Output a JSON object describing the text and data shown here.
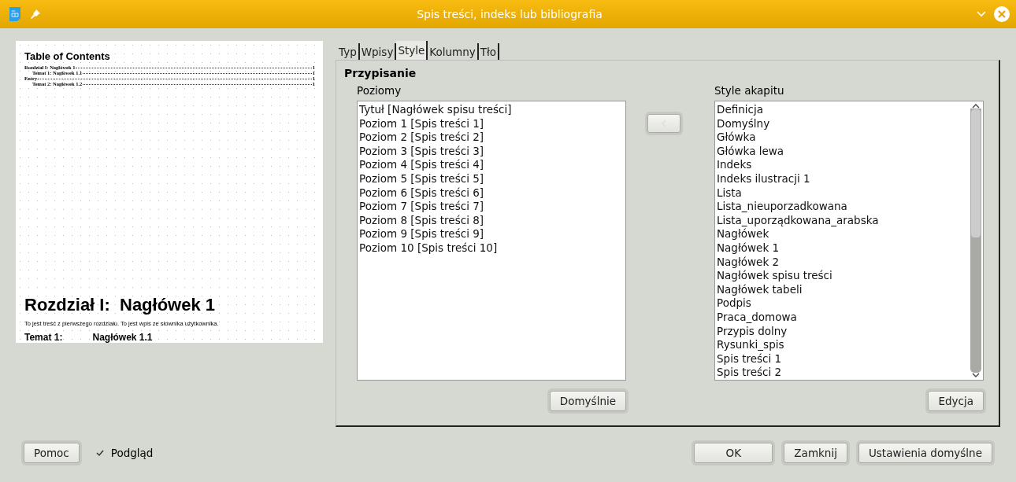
{
  "window": {
    "title": "Spis treści, indeks lub bibliografia"
  },
  "preview": {
    "toc_title": "Table of Contents",
    "toc_entries": [
      {
        "text": "Rozdział I: Nagłówek 1",
        "page": "1",
        "children": [
          {
            "text": "Temat 1: Nagłówek 1.1",
            "page": "1"
          }
        ]
      },
      {
        "text": "Entry",
        "page": "1",
        "children": [
          {
            "text": "Temat 2: Nagłówek 1.2",
            "page": "1"
          }
        ]
      }
    ],
    "heading": "Rozdział I:  Nagłówek 1",
    "body": "To jest treść z pierwszego rozdziału. To jest wpis ze słownika użytkownika.",
    "subheading": {
      "number": "Temat 1:",
      "title": "Nagłówek 1.1"
    }
  },
  "tabs": [
    {
      "label": "Typ",
      "selected": false
    },
    {
      "label": "Wpisy",
      "selected": false
    },
    {
      "label": "Style",
      "selected": true
    },
    {
      "label": "Kolumny",
      "selected": false
    },
    {
      "label": "Tło",
      "selected": false
    }
  ],
  "section_title": "Przypisanie",
  "levels": {
    "label": "Poziomy",
    "items": [
      "Tytuł [Nagłówek spisu treści]",
      "Poziom 1 [Spis treści 1]",
      "Poziom 2 [Spis treści 2]",
      "Poziom 3 [Spis treści 3]",
      "Poziom 4 [Spis treści 4]",
      "Poziom 5 [Spis treści 5]",
      "Poziom 6 [Spis treści 6]",
      "Poziom 7 [Spis treści 7]",
      "Poziom 8 [Spis treści 8]",
      "Poziom 9 [Spis treści 9]",
      "Poziom 10 [Spis treści 10]"
    ]
  },
  "assign_button": {
    "disabled": true
  },
  "styles": {
    "label": "Style akapitu",
    "items": [
      "Definicja",
      "Domyślny",
      "Główka",
      "Główka lewa",
      "Indeks",
      "Indeks ilustracji 1",
      "Lista",
      "Lista_nieuporzadkowana",
      "Lista_uporządkowana_arabska",
      "Nagłówek",
      "Nagłówek 1",
      "Nagłówek 2",
      "Nagłówek spisu treści",
      "Nagłówek tabeli",
      "Podpis",
      "Praca_domowa",
      "Przypis dolny",
      "Rysunki_spis",
      "Spis treści 1",
      "Spis treści 2"
    ]
  },
  "default_button": "Domyślnie",
  "edit_button": "Edycja",
  "help_button": "Pomoc",
  "preview_checkbox": {
    "label": "Podgląd",
    "checked": true
  },
  "buttons": [
    "OK",
    "Zamknij",
    "Ustawienia domyślne"
  ]
}
